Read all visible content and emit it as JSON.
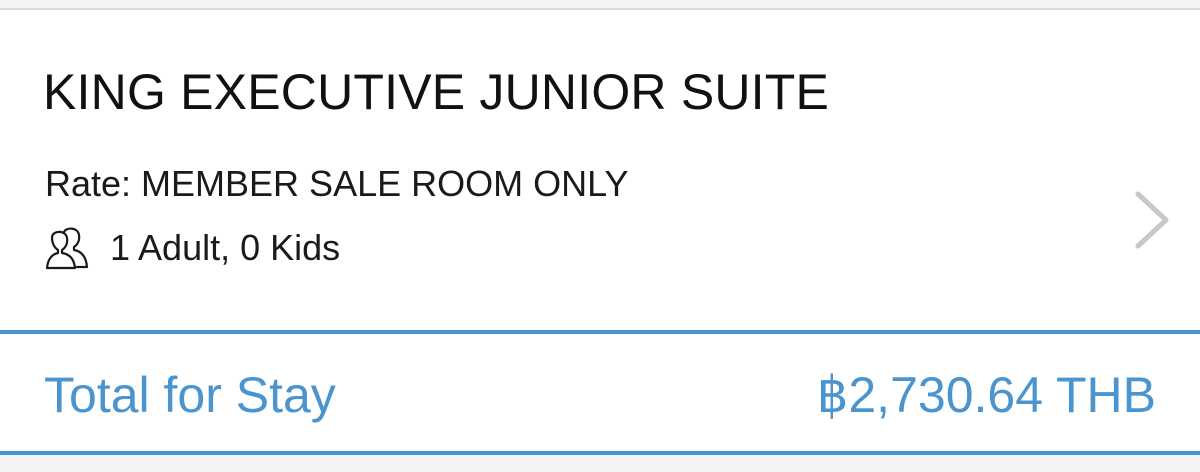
{
  "room": {
    "title": "KING EXECUTIVE JUNIOR SUITE",
    "rate": "Rate: MEMBER SALE ROOM ONLY",
    "guests": "1 Adult, 0 Kids",
    "guests_icon": "people-icon",
    "disclosure_icon": "chevron-right-icon"
  },
  "total": {
    "label": "Total for Stay",
    "amount": "฿2,730.64 THB"
  },
  "colors": {
    "accent": "#4a95cf",
    "text": "#111111",
    "chevron": "#c7c7cc",
    "background": "#ffffff"
  }
}
